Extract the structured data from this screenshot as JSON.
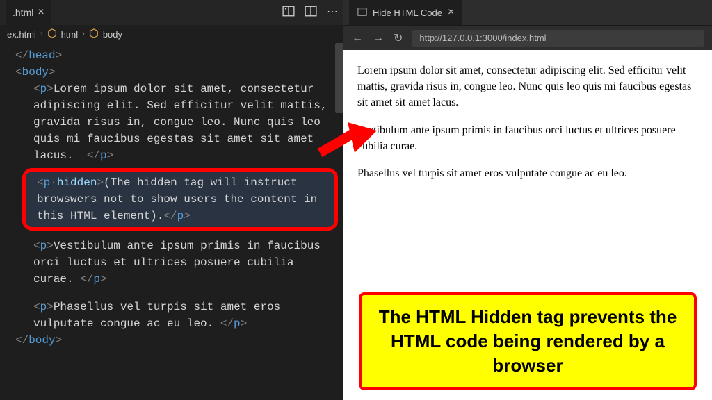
{
  "editor": {
    "tab": {
      "filename": ".html"
    },
    "breadcrumb": {
      "file": "ex.html",
      "path1": "html",
      "path2": "body"
    },
    "code": {
      "line1_close_head": "</head>",
      "line2_open_body": "<body>",
      "p1_text": "Lorem ipsum dolor sit amet, consectetur adipiscing elit. Sed efficitur velit mattis, gravida risus in, congue leo. Nunc quis leo quis mi faucibus egestas sit amet sit amet lacus.  ",
      "hidden_text": "(The hidden tag will instruct browswers not to show users the content in this HTML element).",
      "p3_text": "Vestibulum ante ipsum primis in faucibus orci luctus et ultrices posuere cubilia curae. ",
      "p4_text": "Phasellus vel turpis sit amet eros vulputate congue ac eu leo. ",
      "line_close_body": "</body>"
    }
  },
  "browser": {
    "tab_title": "Hide HTML Code",
    "url": "http://127.0.0.1:3000/index.html",
    "page": {
      "p1": "Lorem ipsum dolor sit amet, consectetur adipiscing elit. Sed efficitur velit mattis, gravida risus in, congue leo. Nunc quis leo quis mi faucibus egestas sit amet sit amet lacus.",
      "p2": "Vestibulum ante ipsum primis in faucibus orci luctus et ultrices posuere cubilia curae.",
      "p3": "Phasellus vel turpis sit amet eros vulputate congue ac eu leo."
    }
  },
  "callout": "The HTML Hidden tag prevents the HTML code being rendered by a browser"
}
